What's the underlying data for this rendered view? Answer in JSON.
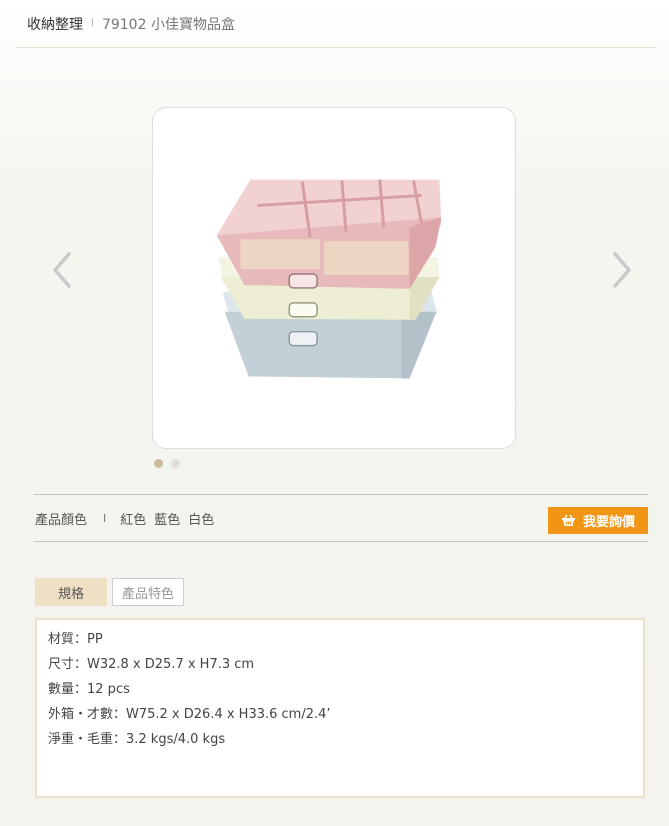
{
  "breadcrumb": {
    "root": "收納整理",
    "separator": "I",
    "current": "79102 小佳寶物品盒"
  },
  "gallery": {
    "prev_icon": "chevron-left-icon",
    "next_icon": "chevron-right-icon",
    "slide_count": 2,
    "active_slide": 1
  },
  "colors": {
    "label": "產品顏色",
    "separator": "I",
    "options": [
      "紅色",
      "藍色",
      "白色"
    ],
    "swatches": {
      "pink": "#e8b9bb",
      "cream": "#eeeed4",
      "blue": "#c3d0d6"
    }
  },
  "inquiry": {
    "label": "我要詢價",
    "icon": "basket-icon",
    "color": "#f09514"
  },
  "tabs": [
    {
      "label": "規格",
      "active": true
    },
    {
      "label": "產品特色",
      "active": false
    }
  ],
  "specs": [
    "材質：PP",
    "尺寸：W32.8 x D25.7 x H7.3 cm",
    "數量：12 pcs",
    "外箱・才數：W75.2 x D26.4 x H33.6 cm/2.4’",
    "淨重・毛重：3.2 kgs/4.0 kgs"
  ]
}
